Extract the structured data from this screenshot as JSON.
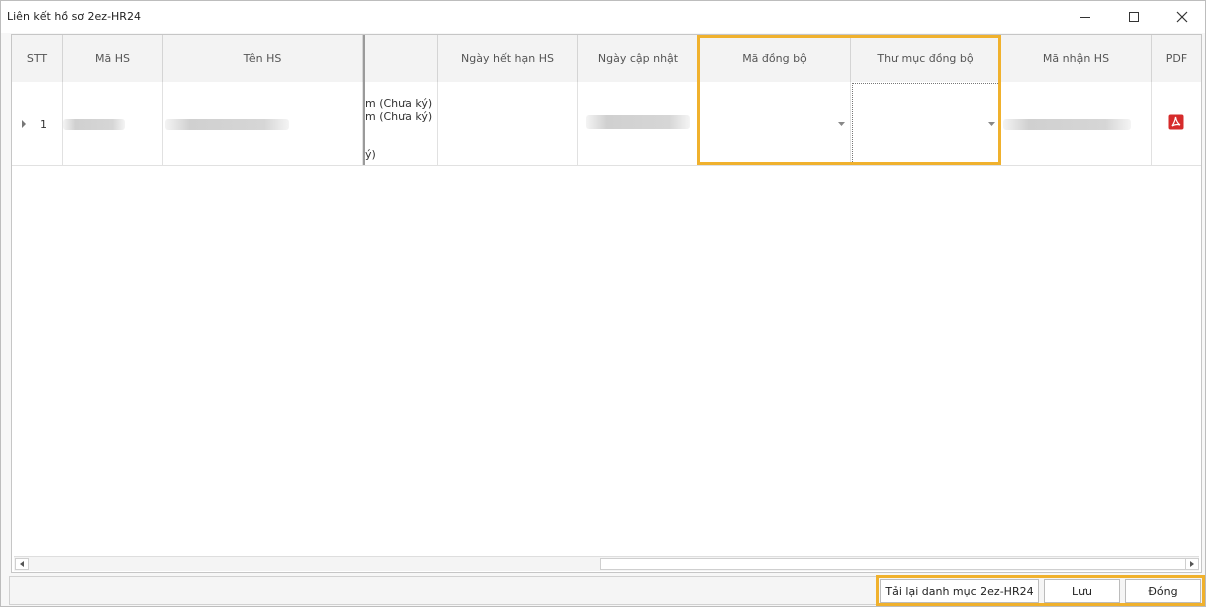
{
  "window": {
    "title": "Liên kết hồ sơ 2ez-HR24"
  },
  "grid": {
    "columns": [
      "STT",
      "Mã HS",
      "Tên HS",
      "",
      "Ngày hết hạn HS",
      "Ngày cập nhật",
      "Mã đồng bộ",
      "Thư mục đồng bộ",
      "Mã nhận HS",
      "PDF"
    ],
    "rows": [
      {
        "stt": "1",
        "partial_lines": [
          "m (Chưa ký)",
          "m (Chưa ký)",
          "ý)"
        ],
        "ngay_het_han": ""
      }
    ]
  },
  "buttons": {
    "reload": "Tải lại danh mục 2ez-HR24",
    "save": "Lưu",
    "close": "Đóng"
  },
  "colors": {
    "highlight": "#f0b12d",
    "pdf_icon": "#d62b2b"
  }
}
